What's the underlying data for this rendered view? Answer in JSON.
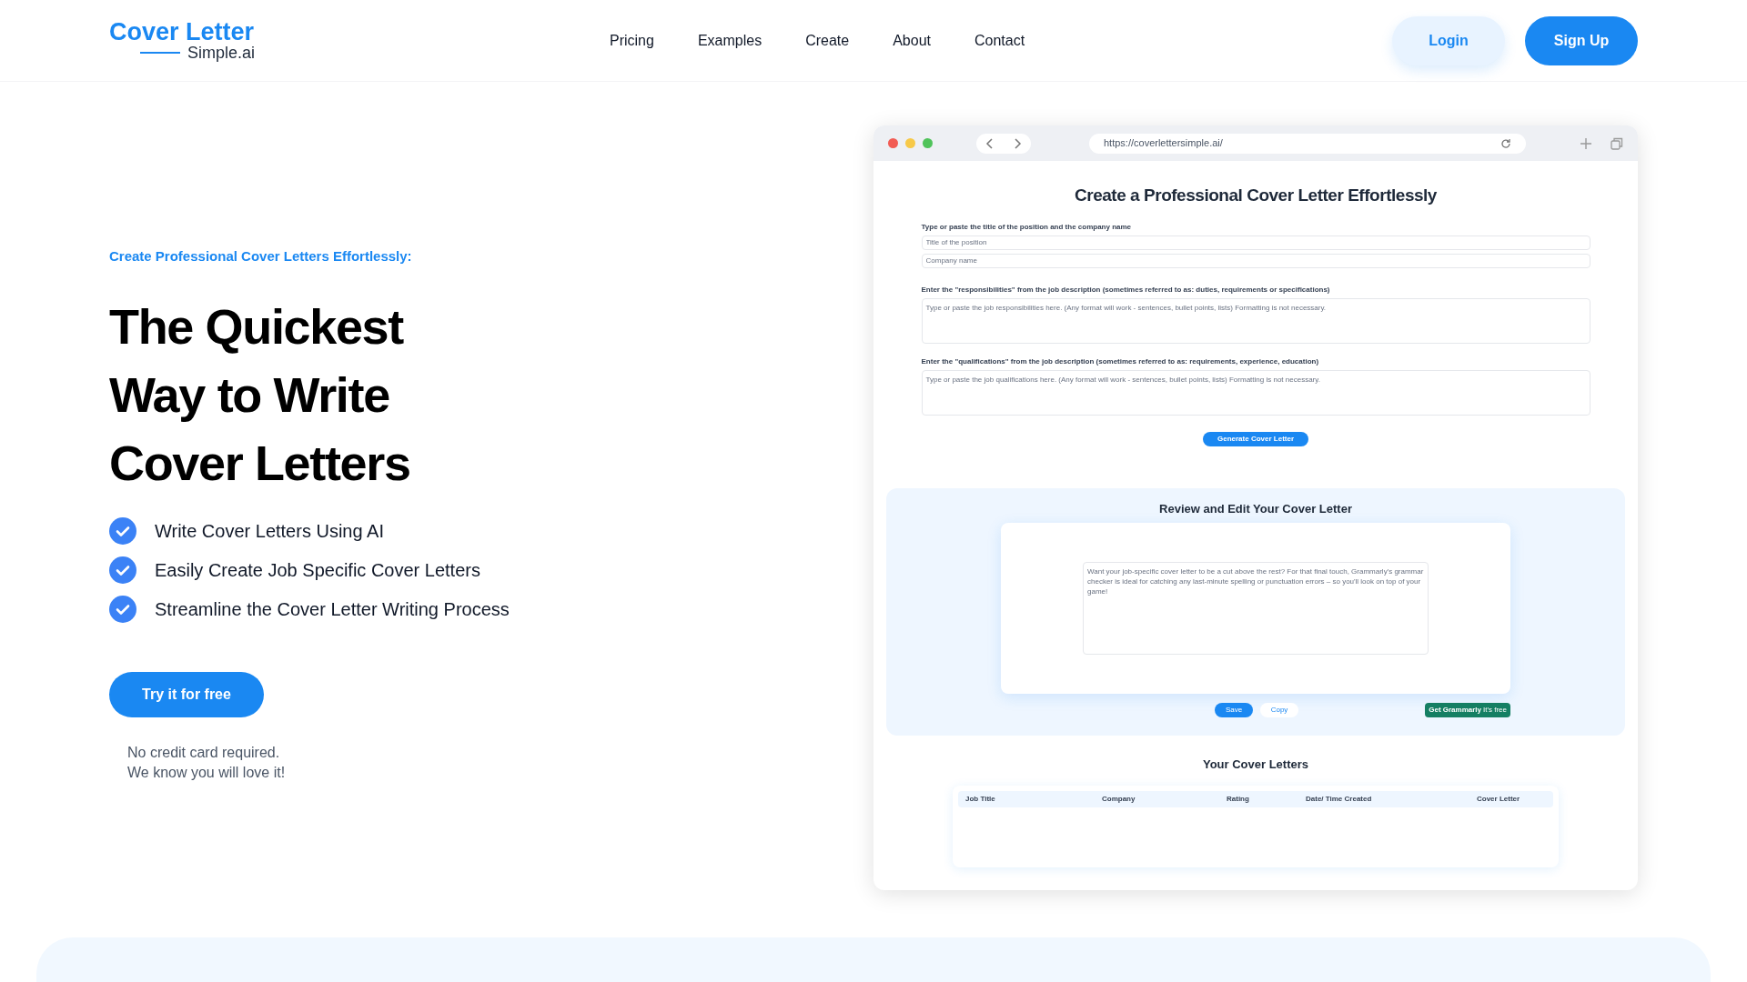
{
  "header": {
    "logo": {
      "main": "Cover Letter",
      "sub": "Simple.ai"
    },
    "nav": [
      "Pricing",
      "Examples",
      "Create",
      "About",
      "Contact"
    ],
    "buttons": [
      {
        "label": "Login",
        "kind": "secondary"
      },
      {
        "label": "Sign Up",
        "kind": "primary"
      }
    ]
  },
  "hero": {
    "eyebrow": "Create Professional Cover Letters Effortlessly:",
    "heading": [
      "The Quickest",
      "Way to Write",
      "Cover Letters"
    ],
    "features": [
      "Write Cover Letters Using AI",
      "Easily Create Job Specific Cover Letters",
      "Streamline the Cover Letter Writing Process"
    ],
    "cta": "Try it for free",
    "note": [
      "No credit card required.",
      "We know you will love it!"
    ]
  },
  "preview": {
    "url": "https://coverlettersimple.ai/",
    "title": "Create a Professional Cover Letter Effortlessly",
    "fields": [
      {
        "label": "Type or paste the title of the position and the company name",
        "kind": "inputs",
        "placeholders": [
          "Title of the position",
          "Company name"
        ]
      },
      {
        "label": "Enter the \"responsibilities\" from the job description (sometimes referred to as: duties, requirements or specifications)",
        "kind": "textarea",
        "placeholders": [
          "Type or paste the job responsibilities here. (Any format will work - sentences, bullet points, lists) Formatting is not necessary."
        ]
      },
      {
        "label": "Enter the \"qualifications\" from the job description (sometimes referred to as: requirements, experience, education)",
        "kind": "textarea",
        "placeholders": [
          "Type or paste the job qualifications here. (Any format will work - sentences, bullet points, lists) Formatting is not necessary."
        ]
      }
    ],
    "generate_button": "Generate Cover Letter",
    "review": {
      "title": "Review and Edit Your Cover Letter",
      "placeholder": "Want your job-specific cover letter to be a cut above the rest? For that final touch, Grammarly's grammar checker is ideal for catching any last-minute spelling or punctuation errors – so you'll look on top of your game!",
      "buttons": [
        {
          "label": "Save",
          "kind": "primary"
        },
        {
          "label": "Copy",
          "kind": "secondary"
        }
      ],
      "promo": {
        "label": "Get Grammarly",
        "suffix": "It's free"
      }
    },
    "letters": {
      "title": "Your Cover Letters",
      "columns": [
        "Job Title",
        "Company",
        "Rating",
        "Date/ Time Created",
        "Cover Letter"
      ]
    }
  }
}
